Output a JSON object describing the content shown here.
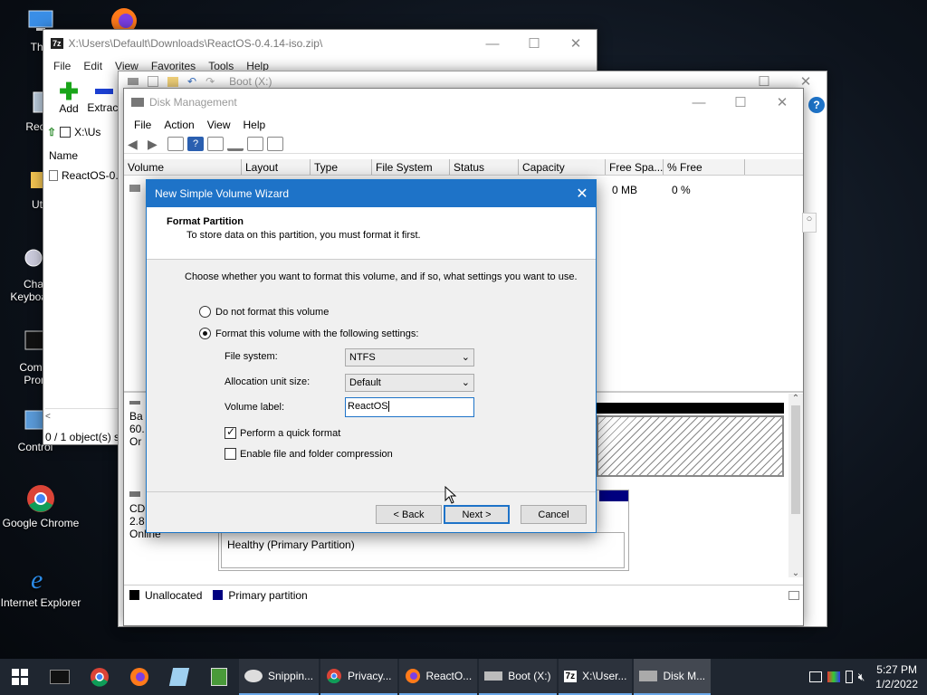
{
  "desktop": {
    "icons": [
      {
        "label": "This",
        "icon": "this-pc-icon"
      },
      {
        "label": "Recyc",
        "icon": "recycle-bin-icon"
      },
      {
        "label": "Utili",
        "icon": "folder-icon"
      },
      {
        "label": "Cha Keyboard",
        "icon": "keyboard-settings-icon"
      },
      {
        "label": "Comm Pron",
        "icon": "command-prompt-icon"
      },
      {
        "label": "Control",
        "icon": "control-panel-icon"
      },
      {
        "label": "Google Chrome",
        "icon": "chrome-icon"
      },
      {
        "label": "Internet Explorer",
        "icon": "ie-icon"
      }
    ]
  },
  "sevenzip": {
    "title": "X:\\Users\\Default\\Downloads\\ReactOS-0.4.14-iso.zip\\",
    "menu": [
      "File",
      "Edit",
      "View",
      "Favorites",
      "Tools",
      "Help"
    ],
    "add_label": "Add",
    "extract_label": "Extract",
    "path": "X:\\Us",
    "name_header": "Name",
    "file_item": "ReactOS-0.",
    "status": "0 / 1 object(s) s"
  },
  "boot": {
    "title": "Boot (X:)"
  },
  "diskmgmt": {
    "title": "Disk Management",
    "menu": [
      "File",
      "Action",
      "View",
      "Help"
    ],
    "columns": [
      "Volume",
      "Layout",
      "Type",
      "File System",
      "Status",
      "Capacity",
      "Free Spa...",
      "% Free"
    ],
    "row_free": "0 MB",
    "row_pct": "0 %",
    "disk0_lines": [
      "Ba",
      "60.",
      "Or"
    ],
    "disk1_lines": [
      "CD",
      "2.8",
      "Online"
    ],
    "partition_status": "Healthy (Primary Partition)",
    "legend_unallocated": "Unallocated",
    "legend_primary": "Primary partition"
  },
  "wizard": {
    "title": "New Simple Volume Wizard",
    "heading": "Format Partition",
    "subheading": "To store data on this partition, you must format it first.",
    "instructions": "Choose whether you want to format this volume, and if so, what settings you want to use.",
    "option_no_format": "Do not format this volume",
    "option_format": "Format this volume with the following settings:",
    "fs_label": "File system:",
    "fs_value": "NTFS",
    "alloc_label": "Allocation unit size:",
    "alloc_value": "Default",
    "vol_label": "Volume label:",
    "vol_value": "ReactOS",
    "quick_format": "Perform a quick format",
    "compression": "Enable file and folder compression",
    "back": "< Back",
    "next": "Next >",
    "cancel": "Cancel"
  },
  "taskbar": {
    "apps": [
      {
        "label": "Snippin...",
        "icon": "snipping-tool-icon"
      },
      {
        "label": "Privacy...",
        "icon": "chrome-icon"
      },
      {
        "label": "ReactO...",
        "icon": "firefox-icon"
      },
      {
        "label": "Boot (X:)",
        "icon": "drive-icon"
      },
      {
        "label": "X:\\User...",
        "icon": "sevenzip-icon"
      },
      {
        "label": "Disk M...",
        "icon": "disk-management-icon"
      }
    ],
    "time": "5:27 PM",
    "date": "1/2/2022"
  }
}
